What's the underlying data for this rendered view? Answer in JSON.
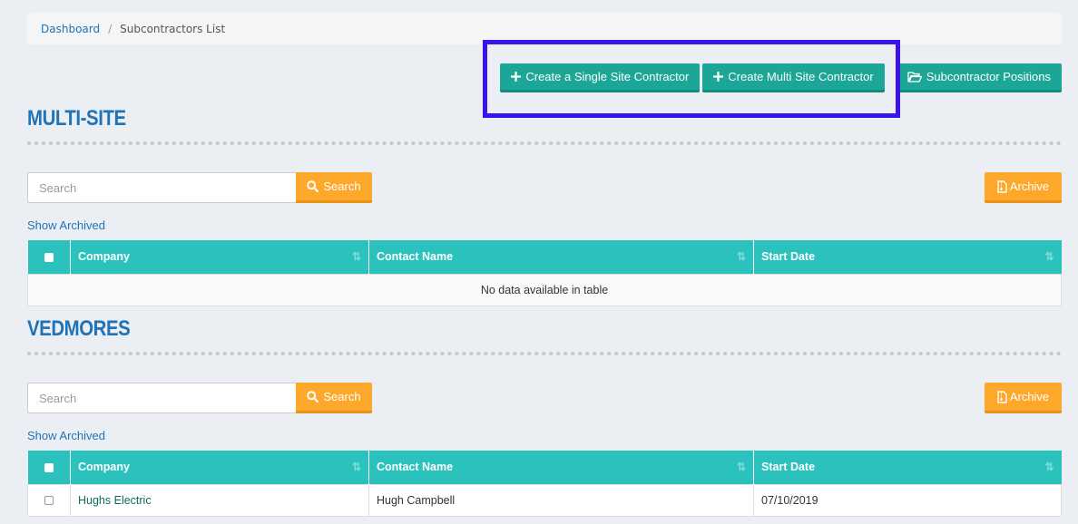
{
  "breadcrumb": {
    "home": "Dashboard",
    "separator": "/",
    "current": "Subcontractors List"
  },
  "actions": {
    "create_single": "Create a Single Site Contractor",
    "create_multi": "Create Multi Site Contractor",
    "positions": "Subcontractor Positions"
  },
  "sections": [
    {
      "title": "MULTI-SITE",
      "search_placeholder": "Search",
      "search_label": "Search",
      "archive_label": "Archive",
      "show_archived": "Show Archived",
      "columns": [
        "Company",
        "Contact Name",
        "Start Date"
      ],
      "empty_text": "No data available in table",
      "rows": []
    },
    {
      "title": "VEDMORES",
      "search_placeholder": "Search",
      "search_label": "Search",
      "archive_label": "Archive",
      "show_archived": "Show Archived",
      "columns": [
        "Company",
        "Contact Name",
        "Start Date"
      ],
      "rows": [
        {
          "company": "Hughs Electric",
          "contact": "Hugh Campbell",
          "start_date": "07/10/2019"
        }
      ]
    }
  ],
  "colors": {
    "accent_blue": "#1f73b7",
    "teal_button": "#1ba698",
    "table_header": "#2bc2be",
    "orange": "#fda82a",
    "highlight": "#3a12ea"
  },
  "icons": {
    "create": "plus-icon",
    "positions": "folder-open-icon",
    "search": "search-icon",
    "archive": "file-archive-icon",
    "sort": "sort-icon"
  }
}
